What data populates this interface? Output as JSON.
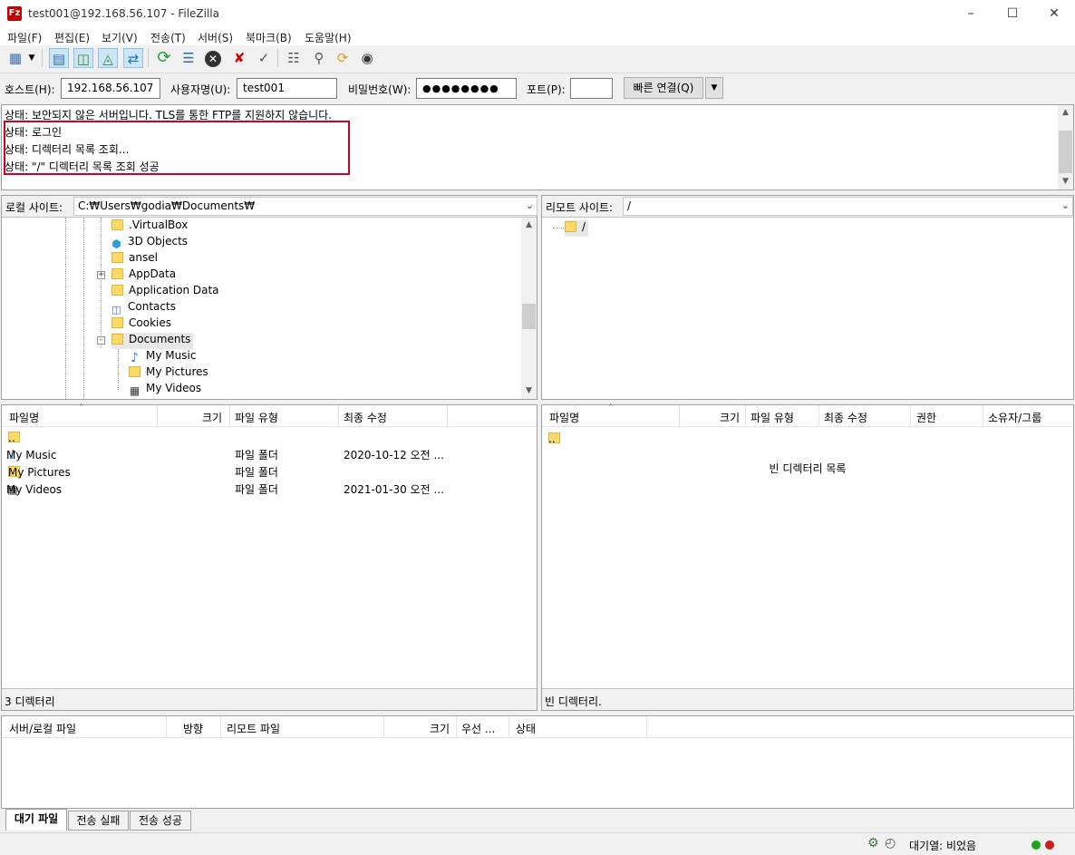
{
  "window": {
    "title": "test001@192.168.56.107 - FileZilla",
    "app_icon": "Fz"
  },
  "menu": [
    "파일(F)",
    "편집(E)",
    "보기(V)",
    "전송(T)",
    "서버(S)",
    "북마크(B)",
    "도움말(H)"
  ],
  "toolbar_icons": [
    "site-manager-icon",
    "dropdown-arrow-icon",
    "toggle-log-icon",
    "toggle-local-tree-icon",
    "toggle-remote-tree-icon",
    "toggle-queue-icon",
    "refresh-icon",
    "process-queue-icon",
    "cancel-icon",
    "disconnect-icon",
    "reconnect-icon",
    "directory-listing-filters-icon",
    "compare-dirs-icon",
    "sync-browsing-icon",
    "search-files-icon"
  ],
  "quickconnect": {
    "host_label": "호스트(H):",
    "host_value": "192.168.56.107",
    "user_label": "사용자명(U):",
    "user_value": "test001",
    "pass_label": "비밀번호(W):",
    "pass_value": "●●●●●●●●",
    "port_label": "포트(P):",
    "port_value": "",
    "connect_label": "빠른 연결(Q)"
  },
  "log": [
    "상태: 보안되지 않은 서버입니다. TLS를 통한 FTP를 지원하지 않습니다.",
    "상태: 로그인",
    "상태: 디렉터리 목록 조회...",
    "상태: \"/\" 디렉터리 목록 조회 성공"
  ],
  "local": {
    "site_label": "로컬 사이트:",
    "path": "C:₩Users₩godia₩Documents₩",
    "tree": [
      {
        "name": ".VirtualBox",
        "icon": "folder"
      },
      {
        "name": "3D Objects",
        "icon": "3d-objects-icon"
      },
      {
        "name": "ansel",
        "icon": "folder"
      },
      {
        "name": "AppData",
        "icon": "folder"
      },
      {
        "name": "Application Data",
        "icon": "folder"
      },
      {
        "name": "Contacts",
        "icon": "contacts-icon"
      },
      {
        "name": "Cookies",
        "icon": "folder"
      },
      {
        "name": "Documents",
        "icon": "folder"
      },
      {
        "name": "My Music",
        "icon": "music-icon"
      },
      {
        "name": "My Pictures",
        "icon": "folder"
      },
      {
        "name": "My Videos",
        "icon": "video-icon"
      }
    ],
    "columns": [
      "파일명",
      "크기",
      "파일 유형",
      "최종 수정"
    ],
    "files": [
      {
        "name": "..",
        "size": "",
        "type": "",
        "modified": ""
      },
      {
        "name": "My Music",
        "size": "",
        "type": "파일 폴더",
        "modified": "2020-10-12 오전 ..."
      },
      {
        "name": "My Pictures",
        "size": "",
        "type": "파일 폴더",
        "modified": ""
      },
      {
        "name": "My Videos",
        "size": "",
        "type": "파일 폴더",
        "modified": "2021-01-30 오전 ..."
      }
    ],
    "status": "3 디렉터리"
  },
  "remote": {
    "site_label": "리모트 사이트:",
    "path": "/",
    "tree": [
      {
        "name": "/"
      }
    ],
    "columns": [
      "파일명",
      "크기",
      "파일 유형",
      "최종 수정",
      "권한",
      "소유자/그룹"
    ],
    "files": [
      {
        "name": ".."
      }
    ],
    "empty_message": "빈 디렉터리 목록",
    "status": "빈 디렉터리."
  },
  "queue": {
    "columns": [
      "서버/로컬 파일",
      "방향",
      "리모트 파일",
      "크기",
      "우선 ...",
      "상태"
    ],
    "tabs": [
      "대기 파일",
      "전송 실패",
      "전송 성공"
    ]
  },
  "statusbar": {
    "queue_text": "대기열: 비었음"
  },
  "colors": {
    "highlight_box": "#d0021b",
    "folder": "#fcd968",
    "led_green": "#1ea51e",
    "led_red": "#c81e1e"
  }
}
